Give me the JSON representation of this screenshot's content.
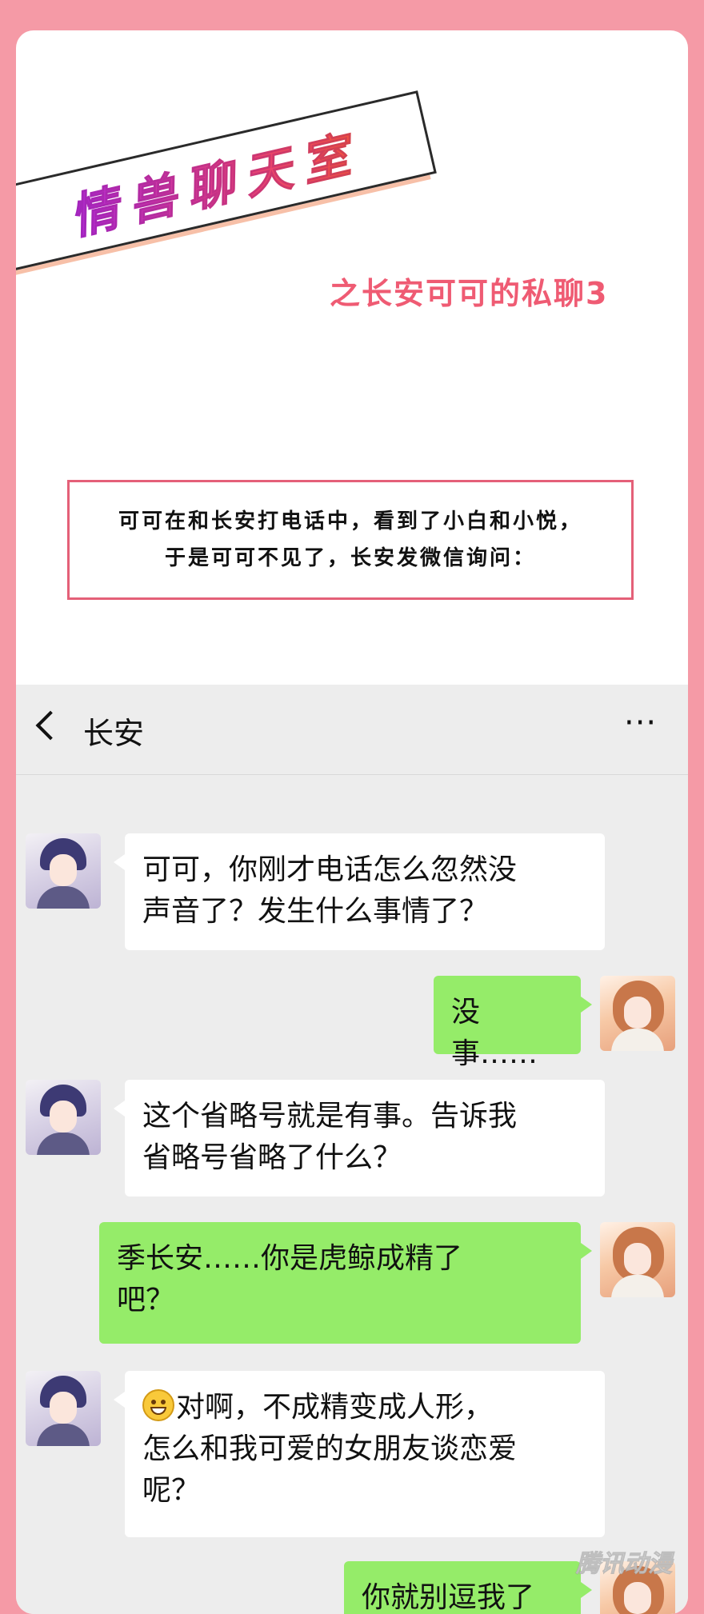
{
  "header": {
    "banner_title": "情兽聊天室",
    "subtitle": "之长安可可的私聊3",
    "intro": [
      "可可在和长安打电话中，看到了小白和小悦，",
      "于是可可不见了，长安发微信询问："
    ]
  },
  "chat": {
    "back_icon": "chevron-left-icon",
    "contact_name": "长安",
    "more_icon": "ellipsis-icon",
    "more_label": "···",
    "messages": [
      {
        "from": "长安",
        "side": "left",
        "lines": [
          "可可，你刚才电话怎么忽然没",
          "声音了？发生什么事情了？"
        ]
      },
      {
        "from": "可可",
        "side": "right",
        "lines": [
          "没事……"
        ]
      },
      {
        "from": "长安",
        "side": "left",
        "lines": [
          "这个省略号就是有事。告诉我",
          "省略号省略了什么？"
        ]
      },
      {
        "from": "可可",
        "side": "right",
        "lines": [
          "季长安……你是虎鲸成精了",
          "吧？"
        ]
      },
      {
        "from": "长安",
        "side": "left",
        "emoji": "grin-emoji",
        "lines": [
          "对啊，不成精变成人形，",
          "怎么和我可爱的女朋友谈恋爱",
          "呢？"
        ]
      },
      {
        "from": "可可",
        "side": "right",
        "lines": [
          "你就别逗我了"
        ]
      }
    ]
  },
  "colors": {
    "page_bg": "#f59aa6",
    "subtitle": "#ef5b73",
    "intro_border": "#e46078",
    "chat_bg": "#ededed",
    "bubble_green": "#95ec69",
    "bubble_white": "#ffffff"
  },
  "watermark": "腾讯动漫"
}
